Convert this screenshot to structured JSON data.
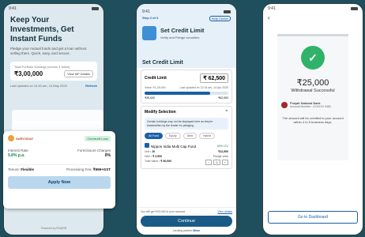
{
  "status_time": "9:41",
  "screen1": {
    "heading": "Keep Your Investments, Get Instant Funds",
    "subtext": "Pledge your mutual funds and get a loan without selling them. Quick, easy, and secure.",
    "holdings_label": "Total Portfolio Holdings (across 4 folios)",
    "holdings_value": "₹3,00,000",
    "view_details": "View MF Details",
    "updated": "Last updated on 10:40 am, 14 May 2025",
    "refresh": "Refresh",
    "lender_name": "SURYODAY",
    "lender_badge": "Overdraft Loan",
    "interest_label": "Interest Rate",
    "interest_value": "9.8% p.a.",
    "foreclosure_label": "Foreclosure Charges",
    "foreclosure_value": "0%",
    "tenure_label": "Tenure:",
    "tenure_value": "Flexible",
    "processing_label": "Processing Fee:",
    "processing_value": "₹999+GST",
    "apply": "Apply Now",
    "powered": "Powered by  FINARB"
  },
  "screen2": {
    "step": "Step 2 of 3",
    "help": "Help Center",
    "title": "Set Credit Limit",
    "subtitle": "Verify and Pledge securities",
    "section": "Set Credit Limit",
    "cl_label": "Credit Limit",
    "cl_value": "₹ 62,500",
    "value_text": "Value: ₹1,25,000",
    "last_updated": "Last updated on 12:34 am, 14 Apr 2025",
    "min_end": "₹25,000",
    "max_end": "₹62,500",
    "slider_fraction": 0.78,
    "modify": "Modify Selection",
    "note": "Certain holdings may not be displayed here as they're blocked/lien by the lender for pledging.",
    "chips": [
      "All Fund",
      "Equity",
      "Debt",
      "Hybrid"
    ],
    "fund_name": "Nippon India Multi Cap Fund",
    "ltv": "50% LTV",
    "unit_label": "Unit",
    "unit_value": ": 20",
    "fund_amount": "₹12,500",
    "nav_label": "NAV",
    "nav_value": ": ₹ 2,500",
    "pledge_label": "Pledge units",
    "total_label": "Total Value",
    "total_value": ": ₹ 50,000",
    "qty": "5",
    "balance": "You will get ₹40,000 in your account",
    "view_details": "View details",
    "continue": "Continue",
    "lending_partner": "Lending partner",
    "partner": "Mirae"
  },
  "screen3": {
    "amount": "₹25,000",
    "status": "Withdrawal Successful",
    "bank_name": "Punjab National Bank",
    "account": "Account Number : XXXXXX 0463",
    "info": "The amount will be credited to your account within 4 to 5 business days.",
    "goto": "Go to Dashboard"
  }
}
